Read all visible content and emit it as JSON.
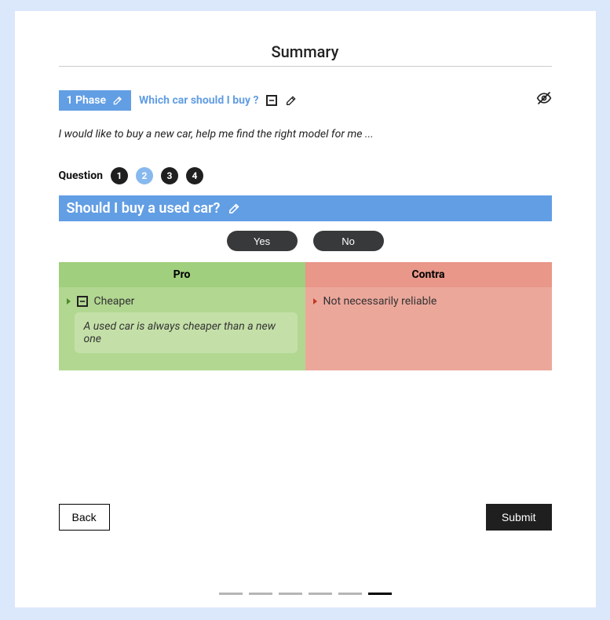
{
  "page": {
    "title": "Summary"
  },
  "phase": {
    "chip_label": "1 Phase",
    "question": "Which car should I buy ?",
    "description": "I would like to buy a new car, help me find the right model for me ..."
  },
  "questions": {
    "label": "Question",
    "items": [
      "1",
      "2",
      "3",
      "4"
    ],
    "active_index": 1
  },
  "current_question": {
    "text": "Should I buy a used car?"
  },
  "answers": {
    "yes": "Yes",
    "no": "No"
  },
  "pro_contra": {
    "pro_header": "Pro",
    "contra_header": "Contra",
    "pro": {
      "title": "Cheaper",
      "detail": "A used car is always cheaper than a new one"
    },
    "contra": {
      "title": "Not necessarily reliable"
    }
  },
  "footer": {
    "back": "Back",
    "submit": "Submit"
  },
  "stepper": {
    "total": 6,
    "active_index": 5
  },
  "icons": {
    "edit": "edit-icon",
    "collapse": "collapse-icon",
    "eye_off": "eye-off-icon"
  },
  "colors": {
    "accent_blue": "#629ee4",
    "dark": "#1f1f1f",
    "pro_bg": "#b2d791",
    "pro_hdr": "#a0cf7d",
    "con_bg": "#eca79b",
    "con_hdr": "#e89789",
    "page_bg": "#dbe7fb"
  }
}
